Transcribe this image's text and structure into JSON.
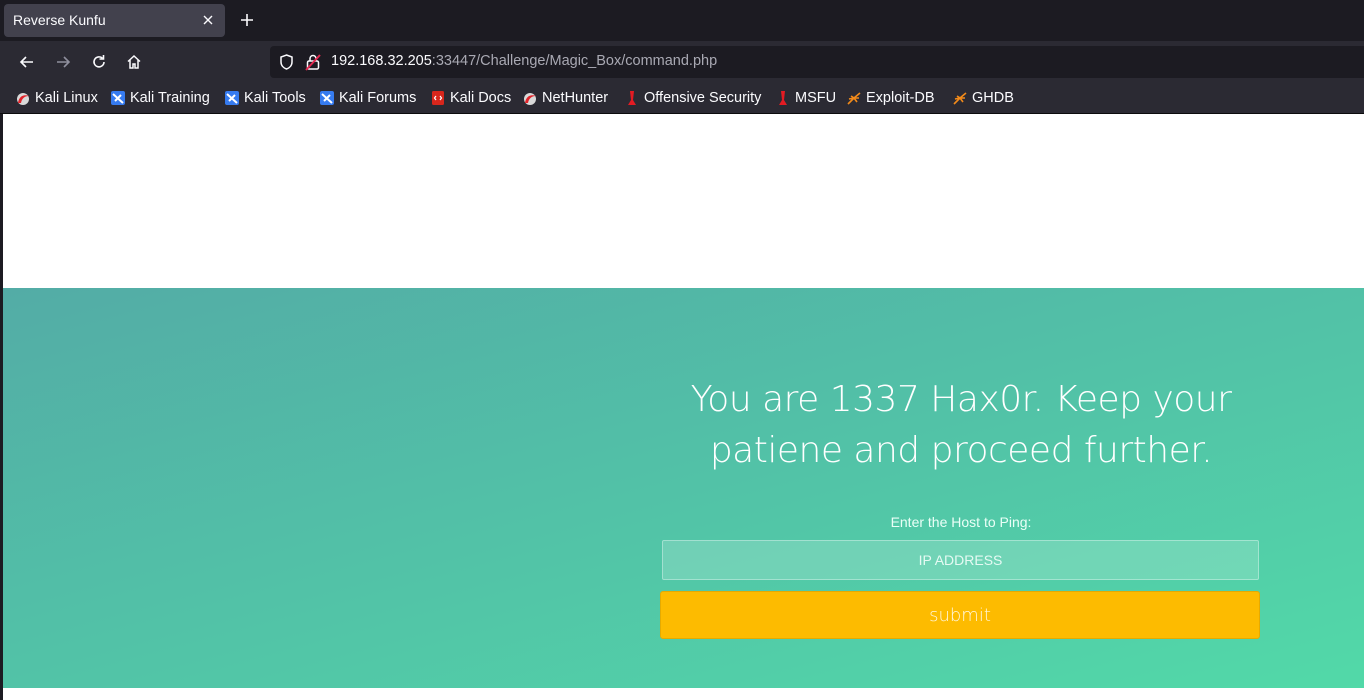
{
  "browser": {
    "tab": {
      "title": "Reverse Kunfu"
    },
    "url": {
      "host": "192.168.32.205",
      "rest": ":33447/Challenge/Magic_Box/command.php"
    },
    "bookmarks": [
      {
        "label": "Kali Linux",
        "icon": "kali-icon"
      },
      {
        "label": "Kali Training",
        "icon": "kali-dragon-icon"
      },
      {
        "label": "Kali Tools",
        "icon": "kali-dragon-icon"
      },
      {
        "label": "Kali Forums",
        "icon": "kali-dragon-icon"
      },
      {
        "label": "Kali Docs",
        "icon": "kali-docs-icon"
      },
      {
        "label": "NetHunter",
        "icon": "kali-icon"
      },
      {
        "label": "Offensive Security",
        "icon": "offsec-icon"
      },
      {
        "label": "MSFU",
        "icon": "offsec-icon"
      },
      {
        "label": "Exploit-DB",
        "icon": "exploitdb-icon"
      },
      {
        "label": "GHDB",
        "icon": "exploitdb-icon"
      }
    ]
  },
  "page": {
    "headline": "You are 1337 Hax0r. Keep your patiene and proceed further.",
    "ping_label": "Enter the Host to Ping:",
    "ip_placeholder": "IP ADDRESS",
    "submit_label": "submit"
  },
  "colors": {
    "hero_gradient_start": "#53aca6",
    "hero_gradient_end": "#52d9a8",
    "submit_button": "#fdbb00",
    "chrome_dark": "#1c1b22",
    "chrome_mid": "#2b2a33"
  }
}
